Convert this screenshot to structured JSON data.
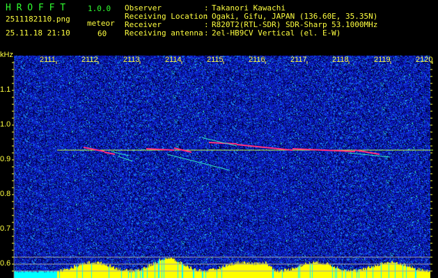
{
  "header": {
    "app_name": "H R O F F T",
    "version": "1.0.0",
    "filename": "2511182110.png",
    "datetime": "25.11.18 21:10",
    "mode_label": "meteor",
    "mode_value": "60",
    "info": [
      {
        "label": "Observer",
        "value": "Takanori Kawachi"
      },
      {
        "label": "Receiving Location",
        "value": "Ogaki, Gifu, JAPAN (136.60E, 35.35N)"
      },
      {
        "label": "Receiver",
        "value": "R820T2(RTL-SDR) SDR-Sharp 53.1000MHz"
      },
      {
        "label": "Receiving antenna",
        "value": "2el-HB9CV Vertical (el. E-W)"
      }
    ]
  },
  "axes": {
    "y_unit": "kHz",
    "y_ticks": [
      "1.1",
      "1.0",
      "0.9",
      "0.8",
      "0.7",
      "0.6"
    ],
    "x_ticks": [
      "2111",
      "2112",
      "2113",
      "2114",
      "2115",
      "2116",
      "2117",
      "2118",
      "2119",
      "2120"
    ]
  },
  "colors": {
    "text": "#ffff40",
    "title": "#30ff30",
    "carrier": "#c0ff40",
    "meteor": "#ff3080",
    "noise": "#0a1ad0",
    "level": "#ffff00",
    "level_low": "#00ffff"
  }
}
